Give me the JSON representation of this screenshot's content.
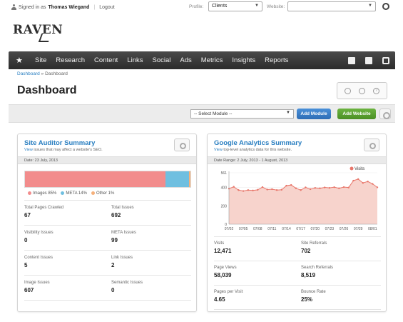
{
  "topbar": {
    "signed_in_as": "Signed in as",
    "user_name": "Thomas Wiegand",
    "logout": "Logout",
    "profile_label": "Profile:",
    "profile_value": "Clients",
    "website_label": "Website:",
    "website_value": ""
  },
  "logo": {
    "text": "RAVEN"
  },
  "nav": {
    "items": [
      "Site",
      "Research",
      "Content",
      "Links",
      "Social",
      "Ads",
      "Metrics",
      "Insights",
      "Reports"
    ]
  },
  "breadcrumb": {
    "home": "Dashboard",
    "sep": "»",
    "current": "Dashboard"
  },
  "page": {
    "title": "Dashboard"
  },
  "modules": {
    "select_placeholder": "-- Select Module --",
    "add_module": "Add Module",
    "add_website": "Add Website"
  },
  "site_auditor": {
    "title": "Site Auditor Summary",
    "sub_link": "View",
    "sub_text": "issues that may affect a website's SEO.",
    "date": "Date: 23 July, 2013",
    "legend": [
      {
        "label": "Images 85%",
        "color": "#f28c8c"
      },
      {
        "label": "META 14%",
        "color": "#6fbfe0"
      },
      {
        "label": "Other 1%",
        "color": "#f5b07a"
      }
    ],
    "composition": {
      "images": 85,
      "meta": 14,
      "other": 1
    },
    "stats": [
      {
        "label": "Total Pages Crawled",
        "value": "67"
      },
      {
        "label": "Total Issues",
        "value": "692"
      },
      {
        "label": "Visibility Issues",
        "value": "0"
      },
      {
        "label": "META Issues",
        "value": "99"
      },
      {
        "label": "Content Issues",
        "value": "5"
      },
      {
        "label": "Link Issues",
        "value": "2"
      },
      {
        "label": "Image Issues",
        "value": "607"
      },
      {
        "label": "Semantic Issues",
        "value": "0"
      }
    ]
  },
  "google_analytics": {
    "title": "Google Analytics Summary",
    "sub_link": "View",
    "sub_text": "top-level analytics data for this website.",
    "date": "Date Range: 2 July, 2013 - 1 August, 2013",
    "legend": "Visits",
    "stats": [
      {
        "label": "Visits",
        "value": "12,471"
      },
      {
        "label": "Site Referrals",
        "value": "702"
      },
      {
        "label": "Page Views",
        "value": "58,039"
      },
      {
        "label": "Search Referrals",
        "value": "8,519"
      },
      {
        "label": "Pages per Visit",
        "value": "4.65"
      },
      {
        "label": "Bounce Rate",
        "value": "25%"
      }
    ]
  },
  "chart_data": {
    "type": "area",
    "series": [
      {
        "name": "Visits",
        "values": [
          388,
          408,
          372,
          362,
          372,
          368,
          375,
          405,
          378,
          382,
          372,
          376,
          420,
          428,
          392,
          372,
          402,
          382,
          396,
          392,
          401,
          396,
          404,
          392,
          405,
          400,
          475,
          492,
          450,
          466,
          440,
          402
        ]
      }
    ],
    "x_tick_labels": [
      "07/02",
      "07/05",
      "07/08",
      "07/11",
      "07/14",
      "07/17",
      "07/20",
      "07/23",
      "07/26",
      "07/29",
      "08/01"
    ],
    "y_tick_labels": [
      "561",
      "400",
      "200",
      "0"
    ],
    "ylim": [
      0,
      561
    ],
    "color": "#e8766a",
    "fill": "#f7d3cc"
  }
}
